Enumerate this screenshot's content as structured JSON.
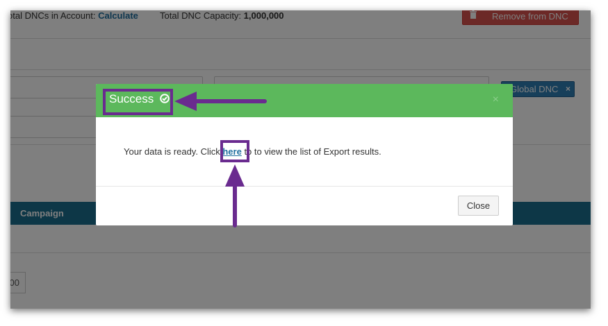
{
  "background": {
    "stats": {
      "total_dncs_label": "otal DNCs in Account:",
      "total_dncs_link": "Calculate",
      "capacity_label": "Total DNC Capacity:",
      "capacity_value": "1,000,000"
    },
    "remove_button_label": "Remove from DNC",
    "filter_tag": {
      "label": "Global DNC",
      "remove": "×"
    },
    "table": {
      "column": "Campaign"
    },
    "pager_value": "00"
  },
  "modal": {
    "title": "Success",
    "close_x": "×",
    "message_before": "Your data is ready. Click ",
    "link_text": "here",
    "message_after": " to to view the list of Export results.",
    "close_button": "Close"
  },
  "colors": {
    "success_header": "#5cb85c",
    "annotation": "#6a2b8f",
    "table_header": "#1a6f8f",
    "danger": "#d9534f",
    "tag": "#2f7fb5"
  },
  "annotations": {
    "icon": "arrow-icon",
    "count": 2
  }
}
